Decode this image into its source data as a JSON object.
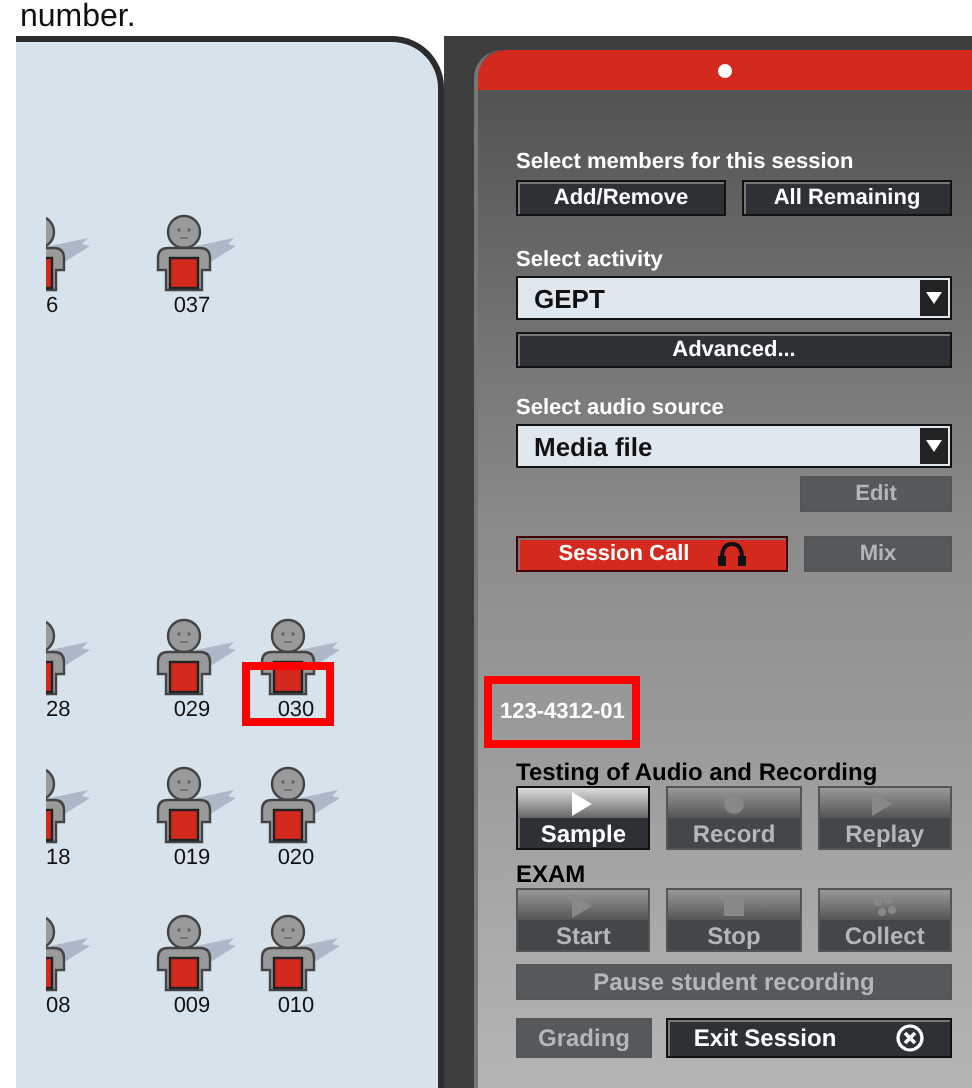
{
  "caption": "number.",
  "student_rows": [
    [
      {
        "label": "6",
        "clipped": true,
        "highlighted": false
      },
      {
        "label": "037",
        "clipped": false,
        "highlighted": false
      }
    ],
    [
      {
        "label": "28",
        "clipped": true,
        "highlighted": false
      },
      {
        "label": "029",
        "clipped": false,
        "highlighted": false
      },
      {
        "label": "030",
        "clipped": false,
        "highlighted": true
      }
    ],
    [
      {
        "label": "18",
        "clipped": true,
        "highlighted": false
      },
      {
        "label": "019",
        "clipped": false,
        "highlighted": false
      },
      {
        "label": "020",
        "clipped": false,
        "highlighted": false
      }
    ],
    [
      {
        "label": "08",
        "clipped": true,
        "highlighted": false
      },
      {
        "label": "009",
        "clipped": false,
        "highlighted": false
      },
      {
        "label": "010",
        "clipped": false,
        "highlighted": false
      }
    ]
  ],
  "panel": {
    "members": {
      "label": "Select members for this session",
      "buttons": [
        {
          "label": "Add/Remove",
          "enabled": true
        },
        {
          "label": "All Remaining",
          "enabled": true
        }
      ]
    },
    "activity": {
      "label": "Select activity",
      "value": "GEPT",
      "advanced": {
        "label": "Advanced...",
        "enabled": true
      }
    },
    "audio": {
      "label": "Select audio source",
      "value": "Media file",
      "edit": {
        "label": "Edit",
        "enabled": false
      }
    },
    "session_call": {
      "label": "Session Call",
      "enabled": true
    },
    "mix": {
      "label": "Mix",
      "enabled": false
    },
    "session_id": {
      "text": "123-4312-01",
      "highlighted": true
    },
    "testing": {
      "label": "Testing of Audio and Recording",
      "buttons": [
        {
          "label": "Sample",
          "kind": "play",
          "enabled": true
        },
        {
          "label": "Record",
          "kind": "record",
          "enabled": false
        },
        {
          "label": "Replay",
          "kind": "play",
          "enabled": false
        }
      ]
    },
    "exam": {
      "label": "EXAM",
      "buttons": [
        {
          "label": "Start",
          "kind": "play",
          "enabled": false
        },
        {
          "label": "Stop",
          "kind": "stop",
          "enabled": false
        },
        {
          "label": "Collect",
          "kind": "collect",
          "enabled": false
        }
      ]
    },
    "pause": {
      "label": "Pause student recording",
      "enabled": false
    },
    "grading": {
      "label": "Grading",
      "enabled": false
    },
    "exit": {
      "label": "Exit Session",
      "enabled": true
    }
  }
}
